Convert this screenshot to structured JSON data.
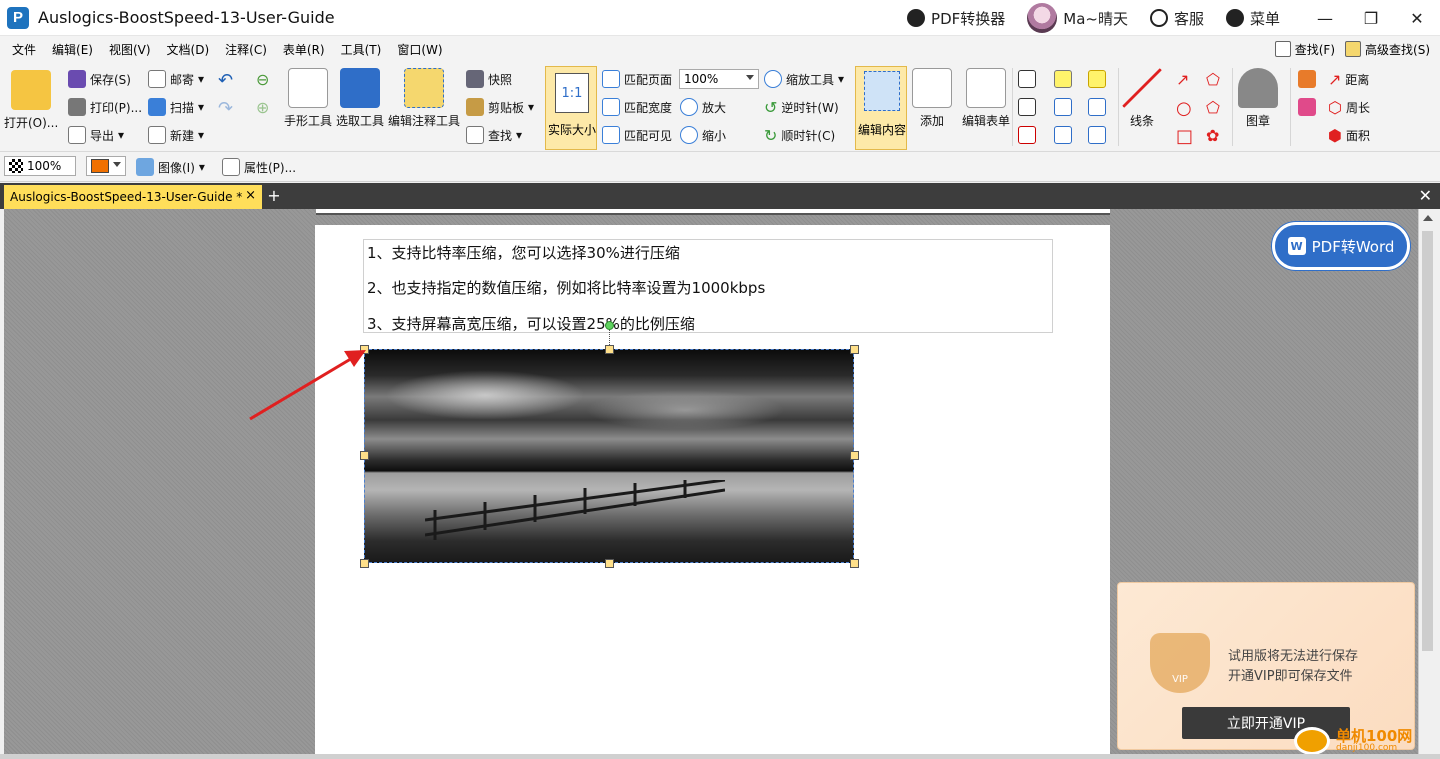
{
  "titlebar": {
    "app_title": "Auslogics-BoostSpeed-13-User-Guide",
    "converter_label": "PDF转换器",
    "username": "Ma~晴天",
    "support_label": "客服",
    "menu_label": "菜单",
    "minimize": "—",
    "restore": "❐",
    "close": "✕"
  },
  "menubar": {
    "items": [
      "文件",
      "编辑(E)",
      "视图(V)",
      "文档(D)",
      "注释(C)",
      "表单(R)",
      "工具(T)",
      "窗口(W)"
    ],
    "find_label": "查找(F)",
    "advanced_find_label": "高级查找(S)"
  },
  "ribbon": {
    "open_label": "打开(O)...",
    "save_label": "保存(S)",
    "print_label": "打印(P)...",
    "export_label": "导出",
    "mail_label": "邮寄",
    "scan_label": "扫描",
    "new_label": "新建",
    "hand_tool_label": "手形工具",
    "select_tool_label": "选取工具",
    "edit_annotation_label": "编辑注释工具",
    "snapshot_label": "快照",
    "clipboard_label": "剪贴板",
    "find_label": "查找",
    "actual_size_label": "实际大小",
    "actual_size_icon_text": "1:1",
    "fit_page_label": "匹配页面",
    "fit_width_label": "匹配宽度",
    "fit_visible_label": "匹配可见",
    "zoom_value": "100%",
    "zoom_tool_label": "缩放工具",
    "zoom_in_label": "放大",
    "zoom_out_label": "缩小",
    "rotate_ccw_label": "逆时针(W)",
    "rotate_cw_label": "顺时针(C)",
    "edit_content_label": "编辑内容",
    "add_label": "添加",
    "edit_form_label": "编辑表单",
    "lines_label": "线条",
    "stamp_label": "图章",
    "distance_label": "距离",
    "perimeter_label": "周长",
    "area_label": "面积"
  },
  "formatbar": {
    "zoom": "100%",
    "image_label": "图像(I)",
    "properties_label": "属性(P)..."
  },
  "tabs": {
    "doc_tab_label": "Auslogics-BoostSpeed-13-User-Guide *",
    "close": "×",
    "add": "+",
    "close_all": "✕"
  },
  "document": {
    "lines": [
      "1、支持比特率压缩，您可以选择30%进行压缩",
      "2、也支持指定的数值压缩，例如将比特率设置为1000kbps",
      "3、支持屏幕高宽压缩，可以设置25%的比例压缩"
    ]
  },
  "pdf_to_word": {
    "label": "PDF转Word",
    "icon_text": "W"
  },
  "vip_popup": {
    "badge_text": "VIP",
    "line1": "试用版将无法进行保存",
    "line2": "开通VIP即可保存文件",
    "button_label": "立即开通VIP"
  },
  "watermark": {
    "text": "单机100网",
    "sub": "danji100.com"
  },
  "colors": {
    "accent_blue": "#2f6ec8",
    "tab_yellow": "#ffde5a",
    "active_tool": "#fde9a8",
    "arrow_red": "#e02020"
  }
}
